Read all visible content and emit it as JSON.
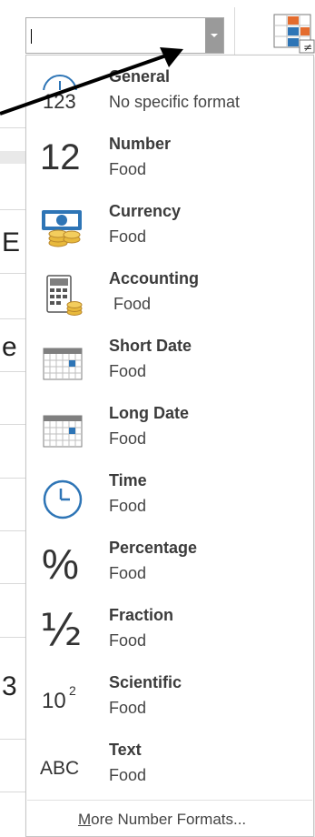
{
  "combo": {
    "value": ""
  },
  "formats": [
    {
      "name": "General",
      "sample": "No specific format",
      "icon": "clock-123-icon"
    },
    {
      "name": "Number",
      "sample": "Food",
      "icon": "number-12-icon"
    },
    {
      "name": "Currency",
      "sample": "Food",
      "icon": "currency-icon"
    },
    {
      "name": "Accounting",
      "sample": " Food",
      "icon": "accounting-icon"
    },
    {
      "name": "Short Date",
      "sample": "Food",
      "icon": "calendar-short-icon"
    },
    {
      "name": "Long Date",
      "sample": "Food",
      "icon": "calendar-long-icon"
    },
    {
      "name": "Time",
      "sample": "Food",
      "icon": "clock-icon"
    },
    {
      "name": "Percentage",
      "sample": "Food",
      "icon": "percent-icon"
    },
    {
      "name": "Fraction",
      "sample": "Food",
      "icon": "fraction-icon"
    },
    {
      "name": "Scientific",
      "sample": "Food",
      "icon": "scientific-icon"
    },
    {
      "name": "Text",
      "sample": "Food",
      "icon": "abc-icon"
    }
  ],
  "icon_text": {
    "general": "123",
    "number": "12",
    "percent": "%",
    "fraction": "½",
    "scientific_base": "10",
    "scientific_exp": "2",
    "text": "ABC"
  },
  "more_formats": {
    "mnemonic": "M",
    "rest": "ore Number Formats..."
  },
  "background_chars": [
    "E",
    "e",
    "3"
  ],
  "colors": {
    "accent_blue": "#2e75b6",
    "coin_gold": "#e8b93c",
    "dropdown_button": "#9a9a9a",
    "item_name": "#3b3b3b"
  }
}
